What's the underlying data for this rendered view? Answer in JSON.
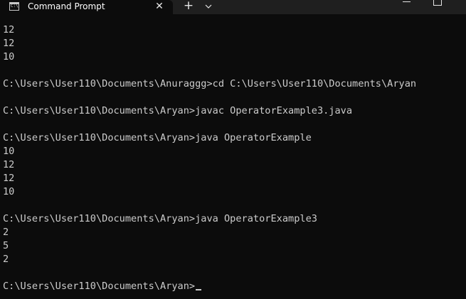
{
  "titlebar": {
    "tab_title": "Command Prompt",
    "tab_icon": "command-prompt-icon",
    "close_icon": "close-icon",
    "new_tab_icon": "plus-icon",
    "dropdown_icon": "chevron-down-icon",
    "minimize_icon": "minimize-icon",
    "maximize_icon": "maximize-icon",
    "icon_glyph": "C:\\"
  },
  "colors": {
    "background": "#0c0c0c",
    "tabbar": "#1f1f1f",
    "text": "#cccccc"
  },
  "terminal": {
    "lines": [
      "12",
      "12",
      "10",
      "",
      "C:\\Users\\User110\\Documents\\Anuraggg>cd C:\\Users\\User110\\Documents\\Aryan",
      "",
      "C:\\Users\\User110\\Documents\\Aryan>javac OperatorExample3.java",
      "",
      "C:\\Users\\User110\\Documents\\Aryan>java OperatorExample",
      "10",
      "12",
      "12",
      "10",
      "",
      "C:\\Users\\User110\\Documents\\Aryan>java OperatorExample3",
      "2",
      "5",
      "2",
      "",
      "C:\\Users\\User110\\Documents\\Aryan>"
    ]
  }
}
